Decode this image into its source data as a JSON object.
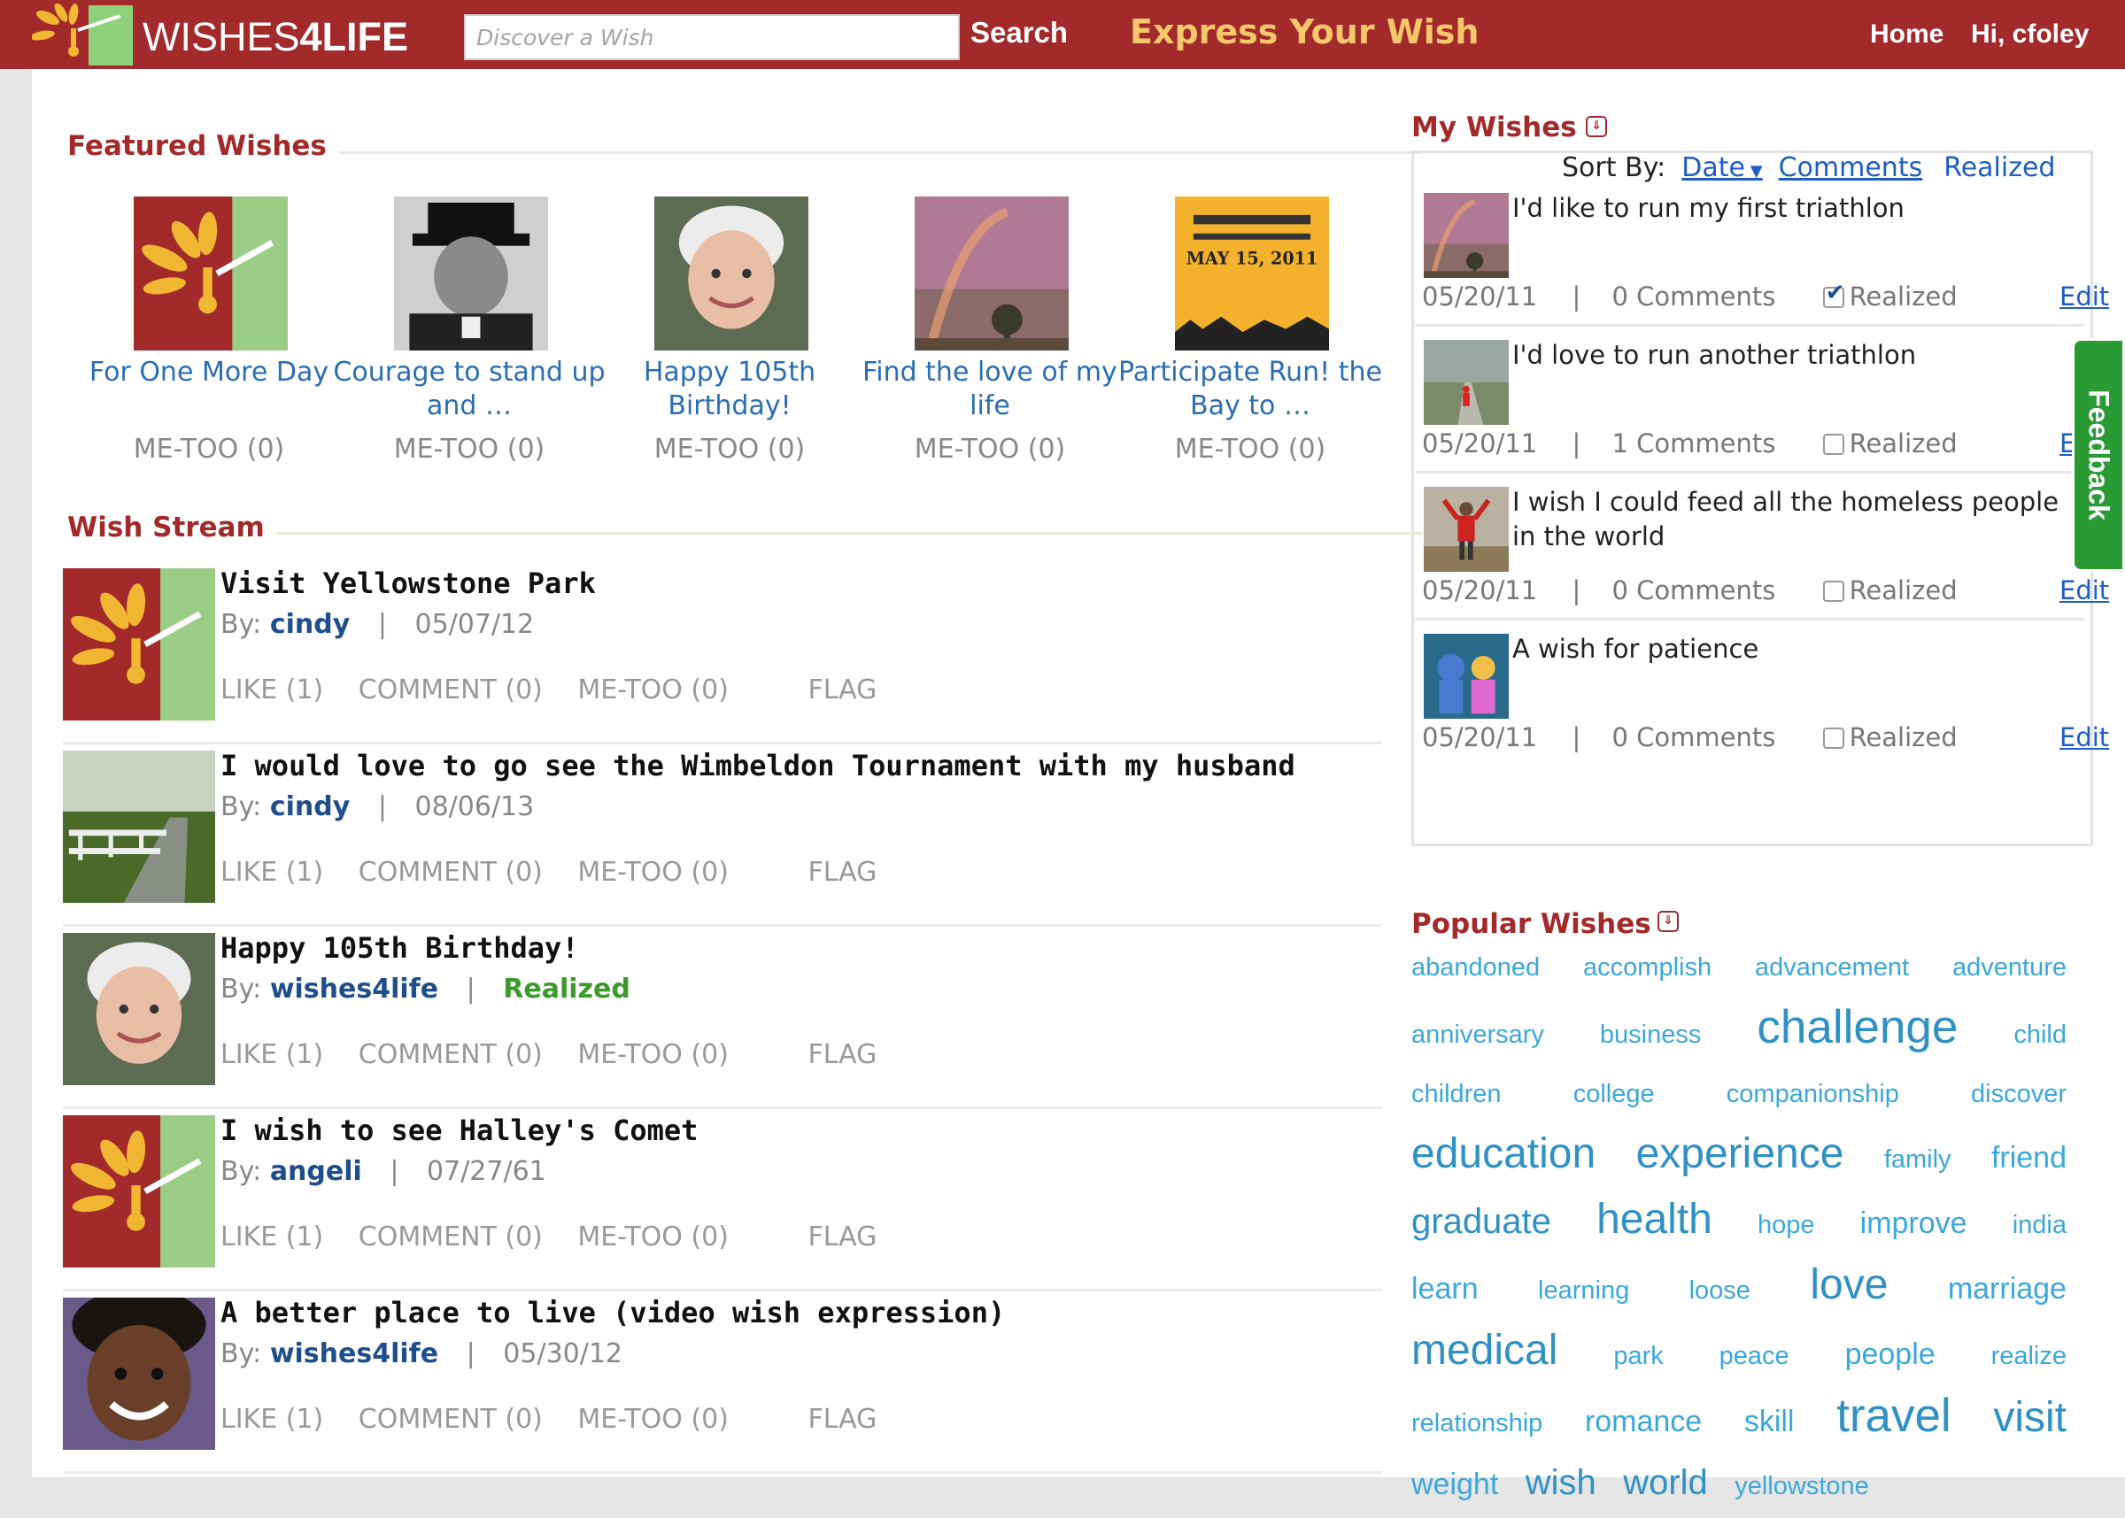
{
  "header": {
    "logo_text_light": "WISHES",
    "logo_text_bold": "4LIFE",
    "search_placeholder": "Discover a Wish",
    "search_button": "Search",
    "express_wish": "Express Your Wish",
    "nav_home": "Home",
    "nav_greeting": "Hi, cfoley"
  },
  "colors": {
    "brand_red": "#a32a2a",
    "accent_gold": "#f6c76b",
    "link_blue": "#1e5ec0",
    "tag_blue": "#3aa8d8",
    "realized_green": "#3a9a2a",
    "feedback_green": "#2a9a35"
  },
  "featured": {
    "title": "Featured Wishes",
    "items": [
      {
        "caption": "For One More Day",
        "metoo": "ME-TOO (0)",
        "image": "wishes4life-logo"
      },
      {
        "caption": "Courage to stand up and …",
        "metoo": "ME-TOO (0)",
        "image": "portrait-man-hat"
      },
      {
        "caption": "Happy 105th Birthday!",
        "metoo": "ME-TOO (0)",
        "image": "portrait-elderly-woman"
      },
      {
        "caption": "Find the love of my life",
        "metoo": "ME-TOO (0)",
        "image": "rainbow-landscape"
      },
      {
        "caption": "Participate Run! the Bay to …",
        "metoo": "ME-TOO (0)",
        "image": "event-poster"
      }
    ],
    "poster_text_top": "MAY 15, 2011"
  },
  "stream": {
    "title": "Wish Stream",
    "by_label": "By:",
    "items": [
      {
        "title": "Visit Yellowstone Park",
        "user": "cindy",
        "date": "05/07/12",
        "image": "wishes4life-logo"
      },
      {
        "title": "I would love to go see the Wimbeldon Tournament with my husband",
        "user": "cindy",
        "date": "08/06/13",
        "image": "garden-path-photo"
      },
      {
        "title": "Happy 105th Birthday!",
        "user": "wishes4life",
        "date": "Realized",
        "image": "portrait-elderly-woman"
      },
      {
        "title": "I wish to see Halley's Comet",
        "user": "angeli",
        "date": "07/27/61",
        "image": "wishes4life-logo"
      },
      {
        "title": "A better place to live (video wish expression)",
        "user": "wishes4life",
        "date": "05/30/12",
        "image": "portrait-child"
      }
    ],
    "actions": {
      "like": "LIKE (1)",
      "comment": "COMMENT (0)",
      "metoo": "ME-TOO (0)",
      "flag": "FLAG"
    }
  },
  "my_wishes": {
    "title": "My Wishes",
    "sort_by": "Sort By:",
    "sort_date": "Date",
    "sort_comments": "Comments",
    "sort_realized": "Realized",
    "realized_label": "Realized",
    "edit_label": "Edit",
    "items": [
      {
        "text": "I'd like to run my first triathlon",
        "date": "05/20/11",
        "comments": "0 Comments",
        "realized": true,
        "image": "rainbow-landscape"
      },
      {
        "text": "I'd love to run another triathlon",
        "date": "05/20/11",
        "comments": "1 Comments",
        "realized": false,
        "image": "runner-road-photo"
      },
      {
        "text": "I wish I could feed all the homeless people in the world",
        "date": "05/20/11",
        "comments": "0 Comments",
        "realized": false,
        "image": "person-arms-up-photo"
      },
      {
        "text": "A wish for patience",
        "date": "05/20/11",
        "comments": "0 Comments",
        "realized": false,
        "image": "kids-photo"
      }
    ]
  },
  "popular": {
    "title": "Popular Wishes",
    "tags": [
      {
        "t": "abandoned",
        "s": 1
      },
      {
        "t": "accomplish",
        "s": 1
      },
      {
        "t": "advancement",
        "s": 1
      },
      {
        "t": "adventure",
        "s": 1
      },
      {
        "t": "anniversary",
        "s": 1
      },
      {
        "t": "business",
        "s": 1
      },
      {
        "t": "challenge",
        "s": 5
      },
      {
        "t": "child",
        "s": 1
      },
      {
        "t": "children",
        "s": 1
      },
      {
        "t": "college",
        "s": 1
      },
      {
        "t": "companionship",
        "s": 1
      },
      {
        "t": "discover",
        "s": 1
      },
      {
        "t": "education",
        "s": 4
      },
      {
        "t": "experience",
        "s": 4
      },
      {
        "t": "family",
        "s": 1
      },
      {
        "t": "friend",
        "s": 2
      },
      {
        "t": "graduate",
        "s": 3
      },
      {
        "t": "health",
        "s": 4
      },
      {
        "t": "hope",
        "s": 1
      },
      {
        "t": "improve",
        "s": 2
      },
      {
        "t": "india",
        "s": 1
      },
      {
        "t": "learn",
        "s": 2
      },
      {
        "t": "learning",
        "s": 1
      },
      {
        "t": "loose",
        "s": 1
      },
      {
        "t": "love",
        "s": 4
      },
      {
        "t": "marriage",
        "s": 2
      },
      {
        "t": "medical",
        "s": 4
      },
      {
        "t": "park",
        "s": 1
      },
      {
        "t": "peace",
        "s": 1
      },
      {
        "t": "people",
        "s": 2
      },
      {
        "t": "realize",
        "s": 1
      },
      {
        "t": "relationship",
        "s": 1
      },
      {
        "t": "romance",
        "s": 2
      },
      {
        "t": "skill",
        "s": 2
      },
      {
        "t": "travel",
        "s": 5
      },
      {
        "t": "visit",
        "s": 4
      },
      {
        "t": "weight",
        "s": 2
      },
      {
        "t": "wish",
        "s": 3
      },
      {
        "t": "world",
        "s": 3
      },
      {
        "t": "yellowstone",
        "s": 1
      }
    ]
  },
  "feedback": {
    "label": "Feedback"
  }
}
